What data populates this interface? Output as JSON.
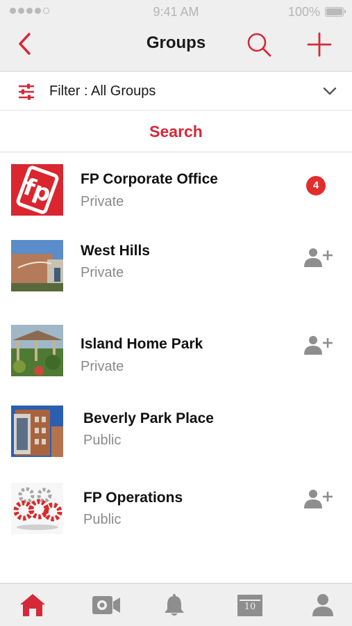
{
  "status_bar": {
    "time": "9:41 AM",
    "battery": "100%"
  },
  "nav": {
    "title": "Groups",
    "back_icon": "chevron-left-icon",
    "search_icon": "search-icon",
    "add_icon": "plus-icon"
  },
  "filter": {
    "label": "Filter : All Groups",
    "icon": "sliders-icon",
    "chevron": "chevron-down-icon"
  },
  "search": {
    "label": "Search"
  },
  "groups": [
    {
      "name": "FP Corporate Office",
      "type": "Private",
      "badge": "4",
      "action": "badge"
    },
    {
      "name": "West Hills",
      "type": "Private",
      "action": "join"
    },
    {
      "name": "Island Home Park",
      "type": "Private",
      "action": "join"
    },
    {
      "name": "Beverly Park Place",
      "type": "Public",
      "action": "none"
    },
    {
      "name": "FP Operations",
      "type": "Public",
      "action": "join"
    }
  ],
  "tab_bar": {
    "tabs": [
      {
        "icon": "home-icon",
        "active": true
      },
      {
        "icon": "video-camera-icon",
        "active": false
      },
      {
        "icon": "bell-icon",
        "active": false
      },
      {
        "icon": "calendar-icon",
        "active": false,
        "day": "10"
      },
      {
        "icon": "person-icon",
        "active": false
      }
    ]
  },
  "colors": {
    "accent": "#d62938",
    "badge": "#e32d2d",
    "bar_background": "#efefef",
    "inactive_icon": "#8e8e8e",
    "secondary_text": "#8a8a8a"
  }
}
